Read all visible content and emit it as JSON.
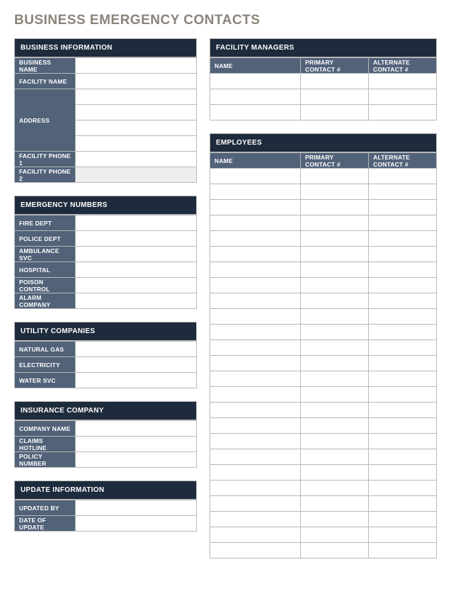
{
  "title": "BUSINESS EMERGENCY CONTACTS",
  "businessInfo": {
    "header": "BUSINESS INFORMATION",
    "labels": {
      "businessName": "BUSINESS NAME",
      "facilityName": "FACILITY NAME",
      "address": "ADDRESS",
      "facilityPhone1": "FACILITY PHONE 1",
      "facilityPhone2": "FACILITY PHONE 2"
    },
    "values": {
      "businessName": "",
      "facilityName": "",
      "address1": "",
      "address2": "",
      "address3": "",
      "address4": "",
      "facilityPhone1": "",
      "facilityPhone2": ""
    }
  },
  "emergencyNumbers": {
    "header": "EMERGENCY NUMBERS",
    "labels": {
      "fireDept": "FIRE DEPT",
      "policeDept": "POLICE DEPT",
      "ambulance": "AMBULANCE SVC",
      "hospital": "HOSPITAL",
      "poison": "POISON CONTROL",
      "alarm": "ALARM COMPANY"
    },
    "values": {
      "fireDept": "",
      "policeDept": "",
      "ambulance": "",
      "hospital": "",
      "poison": "",
      "alarm": ""
    }
  },
  "utilityCompanies": {
    "header": "UTILITY COMPANIES",
    "labels": {
      "naturalGas": "NATURAL GAS",
      "electricity": "ELECTRICITY",
      "waterSvc": "WATER SVC"
    },
    "values": {
      "naturalGas": "",
      "electricity": "",
      "waterSvc": ""
    }
  },
  "insuranceCompany": {
    "header": "INSURANCE COMPANY",
    "labels": {
      "companyName": "COMPANY NAME",
      "claimsHotline": "CLAIMS HOTLINE",
      "policyNumber": "POLICY NUMBER"
    },
    "values": {
      "companyName": "",
      "claimsHotline": "",
      "policyNumber": ""
    }
  },
  "updateInfo": {
    "header": "UPDATE INFORMATION",
    "labels": {
      "updatedBy": "UPDATED BY",
      "dateOfUpdate": "DATE OF UPDATE"
    },
    "values": {
      "updatedBy": "",
      "dateOfUpdate": ""
    }
  },
  "facilityManagers": {
    "header": "FACILITY MANAGERS",
    "columns": {
      "name": "NAME",
      "primary": "PRIMARY CONTACT #",
      "alternate": "ALTERNATE CONTACT #"
    },
    "rows": [
      {
        "name": "",
        "primary": "",
        "alternate": ""
      },
      {
        "name": "",
        "primary": "",
        "alternate": ""
      },
      {
        "name": "",
        "primary": "",
        "alternate": ""
      }
    ]
  },
  "employees": {
    "header": "EMPLOYEES",
    "columns": {
      "name": "NAME",
      "primary": "PRIMARY CONTACT #",
      "alternate": "ALTERNATE CONTACT #"
    },
    "rows": [
      {
        "name": "",
        "primary": "",
        "alternate": ""
      },
      {
        "name": "",
        "primary": "",
        "alternate": ""
      },
      {
        "name": "",
        "primary": "",
        "alternate": ""
      },
      {
        "name": "",
        "primary": "",
        "alternate": ""
      },
      {
        "name": "",
        "primary": "",
        "alternate": ""
      },
      {
        "name": "",
        "primary": "",
        "alternate": ""
      },
      {
        "name": "",
        "primary": "",
        "alternate": ""
      },
      {
        "name": "",
        "primary": "",
        "alternate": ""
      },
      {
        "name": "",
        "primary": "",
        "alternate": ""
      },
      {
        "name": "",
        "primary": "",
        "alternate": ""
      },
      {
        "name": "",
        "primary": "",
        "alternate": ""
      },
      {
        "name": "",
        "primary": "",
        "alternate": ""
      },
      {
        "name": "",
        "primary": "",
        "alternate": ""
      },
      {
        "name": "",
        "primary": "",
        "alternate": ""
      },
      {
        "name": "",
        "primary": "",
        "alternate": ""
      },
      {
        "name": "",
        "primary": "",
        "alternate": ""
      },
      {
        "name": "",
        "primary": "",
        "alternate": ""
      },
      {
        "name": "",
        "primary": "",
        "alternate": ""
      },
      {
        "name": "",
        "primary": "",
        "alternate": ""
      },
      {
        "name": "",
        "primary": "",
        "alternate": ""
      },
      {
        "name": "",
        "primary": "",
        "alternate": ""
      },
      {
        "name": "",
        "primary": "",
        "alternate": ""
      },
      {
        "name": "",
        "primary": "",
        "alternate": ""
      },
      {
        "name": "",
        "primary": "",
        "alternate": ""
      },
      {
        "name": "",
        "primary": "",
        "alternate": ""
      }
    ]
  }
}
